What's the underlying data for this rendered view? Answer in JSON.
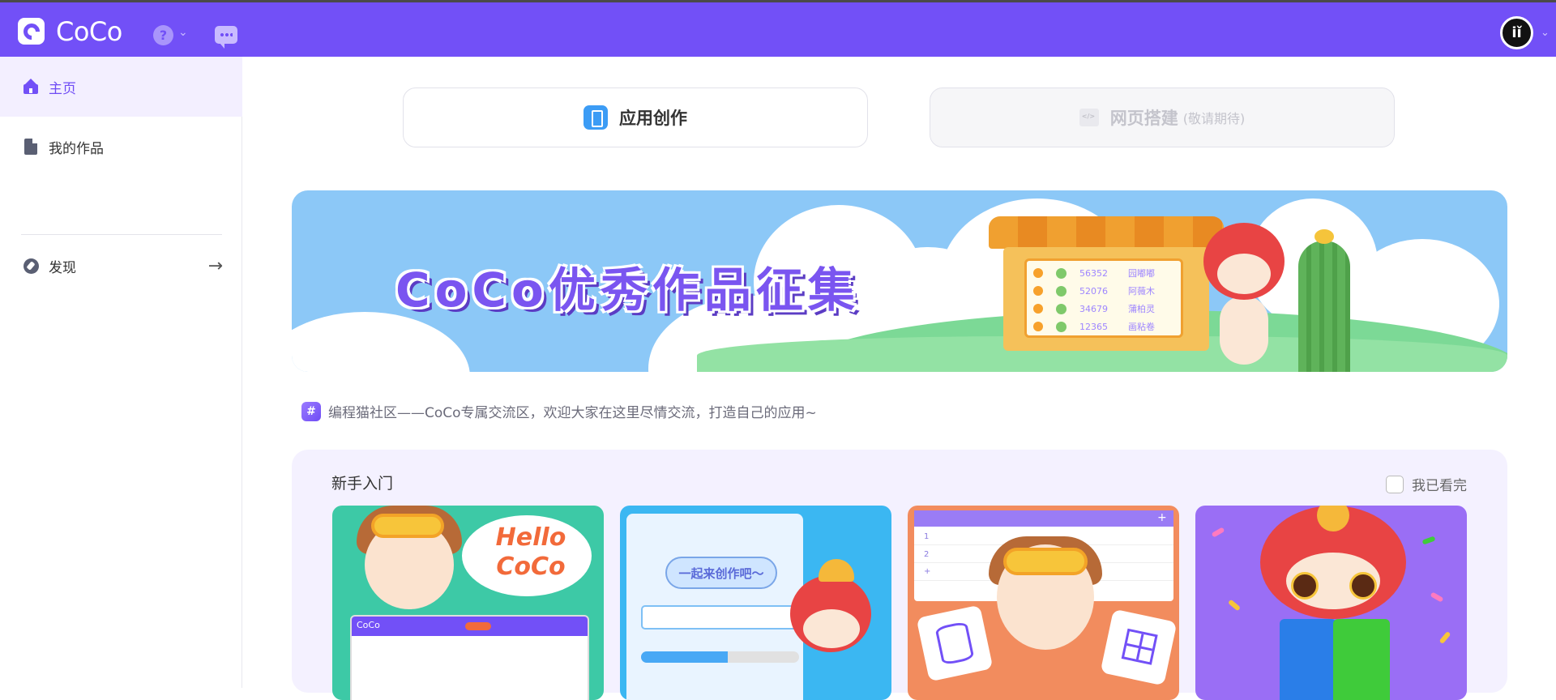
{
  "topbar": {
    "app_name": "CoCo",
    "avatar_text": "iǐ",
    "icons": [
      "coco-logo-icon",
      "help-icon",
      "chevron-down-icon",
      "chat-icon",
      "avatar"
    ]
  },
  "sidebar": {
    "items": [
      {
        "label": "主页",
        "icon": "home-icon",
        "active": true
      },
      {
        "label": "我的作品",
        "icon": "document-icon",
        "active": false
      },
      {
        "label": "发现",
        "icon": "compass-icon",
        "active": false,
        "trailing": "→"
      }
    ]
  },
  "tabs": [
    {
      "label": "应用创作",
      "icon": "phone-icon",
      "enabled": true
    },
    {
      "label": "网页搭建",
      "sub": "(敬请期待)",
      "icon": "code-icon",
      "enabled": false
    }
  ],
  "banner": {
    "title": "CoCo优秀作品征集",
    "leaderboard": [
      {
        "score": "56352",
        "name": "园嘟嘟"
      },
      {
        "score": "52076",
        "name": "阿薇木"
      },
      {
        "score": "34679",
        "name": "蒲柏灵"
      },
      {
        "score": "12365",
        "name": "画粘卷"
      }
    ]
  },
  "community": {
    "icon": "hash-icon",
    "text": "编程猫社区——CoCo专属交流区，欢迎大家在这里尽情交流，打造自己的应用~"
  },
  "beginner": {
    "title": "新手入门",
    "checkbox_label": "我已看完",
    "checked": false,
    "cards": [
      {
        "illustration_text": "Hello CoCo",
        "window_label": "CoCo"
      },
      {
        "illustration_text": "一起来创作吧～"
      },
      {
        "rows": [
          "1",
          "2",
          "+"
        ],
        "header_plus": "+"
      },
      {}
    ]
  },
  "colors": {
    "brand": "#7250f7",
    "active_bg": "#f3efff",
    "banner_sky": "#8cc8f7"
  }
}
